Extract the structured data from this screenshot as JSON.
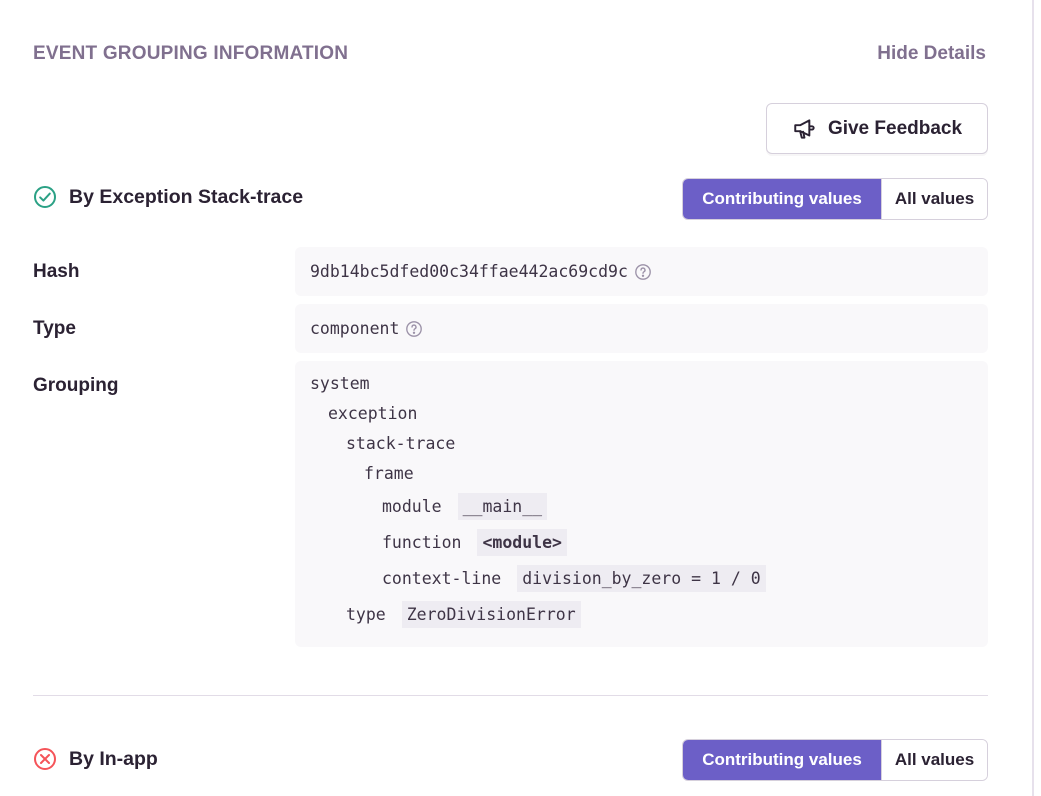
{
  "header": {
    "title": "EVENT GROUPING INFORMATION",
    "hide_details": "Hide Details"
  },
  "feedback": {
    "label": "Give Feedback",
    "icon": "megaphone-icon"
  },
  "variants": [
    {
      "title": "By Exception Stack-trace",
      "status": "contributing",
      "status_icon": "check-circle-icon",
      "status_color": "#2ba185",
      "toggle": {
        "active": "Contributing values",
        "inactive": "All values"
      },
      "rows": {
        "hash_label": "Hash",
        "hash_value": "9db14bc5dfed00c34ffae442ac69cd9c",
        "type_label": "Type",
        "type_value": "component",
        "grouping_label": "Grouping"
      },
      "grouping_tree": {
        "system": "system",
        "exception": "exception",
        "stacktrace": "stack-trace",
        "frame": "frame",
        "module_key": "module",
        "module_val": "__main__",
        "function_key": "function",
        "function_val": "<module>",
        "context_key": "context-line",
        "context_val": "division_by_zero = 1 / 0",
        "type_key": "type",
        "type_val": "ZeroDivisionError"
      }
    },
    {
      "title": "By In-app",
      "status": "non-contributing",
      "status_icon": "x-circle-icon",
      "status_color": "#f55459",
      "toggle": {
        "active": "Contributing values",
        "inactive": "All values"
      }
    }
  ],
  "colors": {
    "accent": "#6c5fc7",
    "muted": "#80708f",
    "code_bg": "#f9f8fa"
  }
}
